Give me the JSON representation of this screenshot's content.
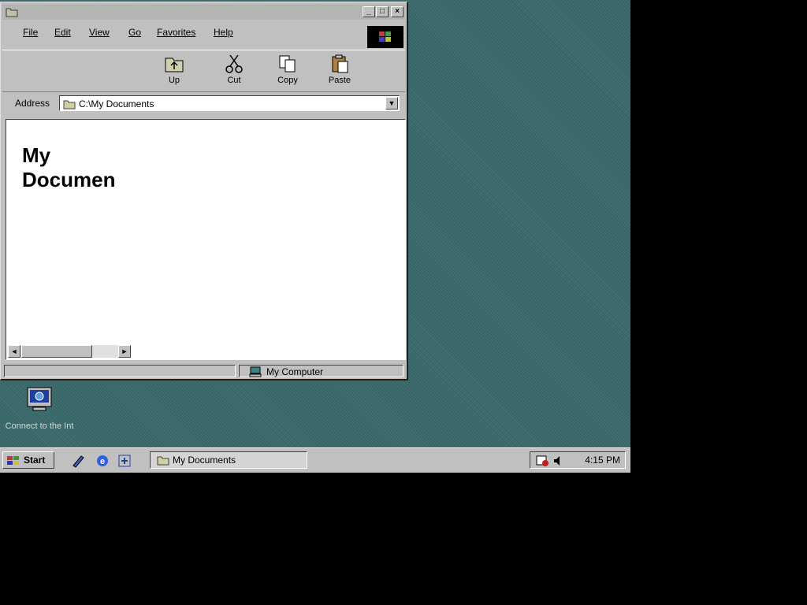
{
  "window": {
    "title": "",
    "buttons": {
      "minimize": "_",
      "maximize": "□",
      "close": "×"
    }
  },
  "menu": [
    {
      "label": "File"
    },
    {
      "label": "Edit"
    },
    {
      "label": "View"
    },
    {
      "label": "Go"
    },
    {
      "label": "Favorites"
    },
    {
      "label": "Help"
    }
  ],
  "toolbar": {
    "up": "Up",
    "cut": "Cut",
    "copy": "Copy",
    "paste": "Paste"
  },
  "address": {
    "label": "Address",
    "value": "C:\\My Documents"
  },
  "content": {
    "folder_title": "My Documen"
  },
  "status": {
    "location": "My Computer"
  },
  "desktop": {
    "icon_label": "Connect to the Int"
  },
  "taskbar": {
    "start": "Start",
    "task": "My Documents",
    "clock": "4:15 PM"
  },
  "colors": {
    "desktop": "#3e6e70",
    "chrome": "#c0c0c0"
  },
  "icons": {
    "window": "folder-icon",
    "up": "up-folder-icon",
    "cut": "scissors-icon",
    "copy": "copy-icon",
    "paste": "clipboard-icon",
    "address": "folder-icon",
    "status": "computer-icon",
    "desktop": "connect-internet-icon",
    "start": "windows-logo-icon",
    "quicklaunch": [
      "show-desktop-icon",
      "internet-explorer-icon",
      "channels-icon"
    ],
    "tray": [
      "scheduler-icon",
      "volume-icon"
    ]
  }
}
